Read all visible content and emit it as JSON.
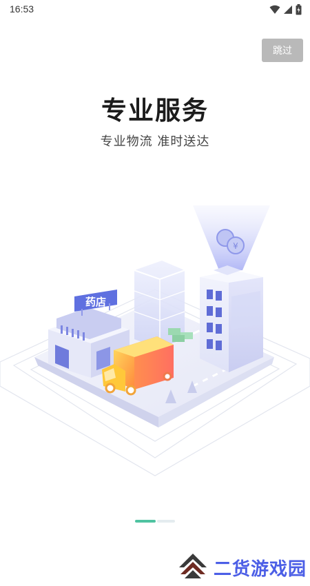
{
  "status_bar": {
    "time": "16:53"
  },
  "skip_label": "跳过",
  "title": "专业服务",
  "subtitle": "专业物流 准时送达",
  "illustration": {
    "store_sign": "药店"
  },
  "pager": {
    "current": 1,
    "total": 2
  },
  "watermark": {
    "text": "二货游戏园"
  },
  "colors": {
    "accent": "#4fc3a1",
    "skip_bg": "#b9b9b9",
    "watermark": "#4b5ee6"
  }
}
